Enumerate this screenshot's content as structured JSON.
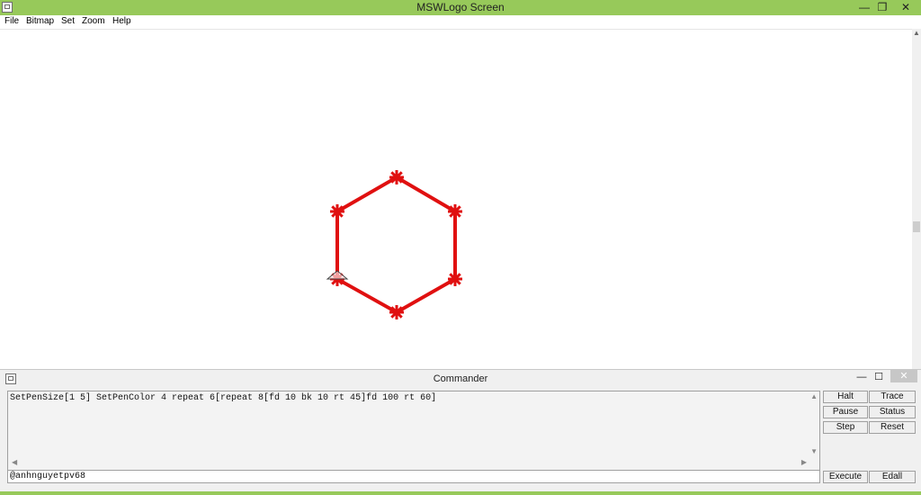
{
  "window": {
    "title": "MSWLogo Screen",
    "minimize": "—",
    "maximize": "❐",
    "close": "✕"
  },
  "menu": {
    "items": [
      "File",
      "Bitmap",
      "Set",
      "Zoom",
      "Help"
    ]
  },
  "drawing": {
    "pen_color": "#e01010",
    "pen_size": 5,
    "shape": "hexagon with star marks at each vertex"
  },
  "commander": {
    "title": "Commander",
    "minimize": "—",
    "maximize": "☐",
    "close": "✕",
    "history_line": "SetPenSize[1 5] SetPenColor 4 repeat 6[repeat 8[fd 10 bk 10 rt 45]fd 100 rt 60]",
    "input_value": "@anhnguyetpv68",
    "buttons": {
      "halt": "Halt",
      "trace": "Trace",
      "pause": "Pause",
      "status": "Status",
      "step": "Step",
      "reset": "Reset",
      "execute": "Execute",
      "edall": "Edall"
    }
  },
  "colors": {
    "titlebar": "#97c95a",
    "pen": "#e01010"
  }
}
